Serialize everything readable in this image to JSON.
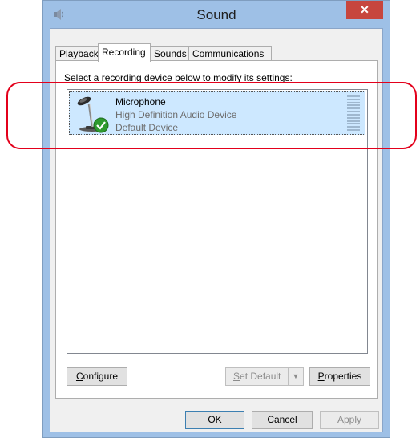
{
  "window": {
    "title": "Sound",
    "close_label": "✕"
  },
  "tabs": [
    {
      "label": "Playback"
    },
    {
      "label": "Recording"
    },
    {
      "label": "Sounds"
    },
    {
      "label": "Communications"
    }
  ],
  "recording": {
    "instructions": "Select a recording device below to modify its settings:",
    "device": {
      "name": "Microphone",
      "description": "High Definition Audio Device",
      "status": "Default Device",
      "icon": "microphone-icon",
      "status_icon": "check-icon",
      "level": 0
    },
    "buttons": {
      "configure": {
        "mnemonic": "C",
        "rest": "onfigure"
      },
      "set_default": {
        "mnemonic": "S",
        "rest": "et Default"
      },
      "properties": {
        "mnemonic": "P",
        "rest": "roperties"
      }
    }
  },
  "dialog_buttons": {
    "ok": "OK",
    "cancel": "Cancel",
    "apply": {
      "mnemonic": "A",
      "rest": "pply"
    }
  },
  "colors": {
    "selection": "#cde8ff",
    "annotation": "#e3001b",
    "close_button": "#c7463e",
    "frame": "#9ec0e6"
  }
}
